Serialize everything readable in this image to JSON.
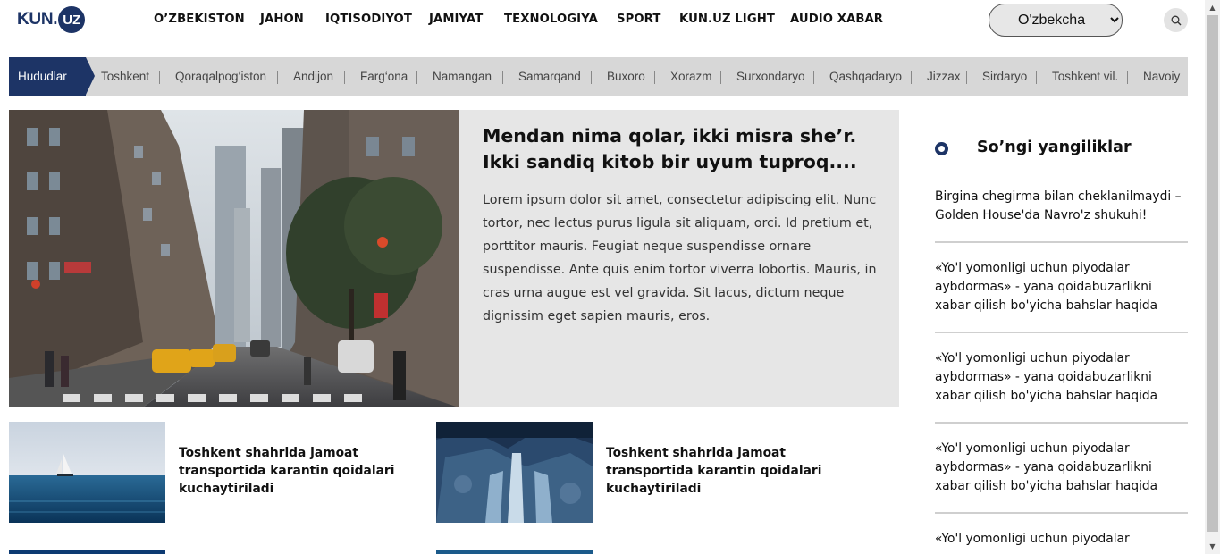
{
  "logo": {
    "text_a": "KUN.",
    "text_b": "UZ"
  },
  "nav": {
    "items": [
      "O’ZBEKISTON",
      "JAHON",
      "IQTISODIYOT",
      "JAMIYAT",
      "TEXNOLOGIYA",
      "SPORT",
      "KUN.UZ LIGHT",
      "AUDIO XABAR"
    ]
  },
  "language": {
    "selected": "O'zbekcha"
  },
  "search": {
    "icon": "search-icon"
  },
  "regions": {
    "heading": "Hududlar",
    "items": [
      "Toshkent",
      "Qoraqalpog‘iston",
      "Andijon",
      "Farg‘ona",
      "Namangan",
      "Samarqand",
      "Buxoro",
      "Xorazm",
      "Surxondaryo",
      "Qashqadaryo",
      "Jizzax",
      "Sirdaryo",
      "Toshkent vil.",
      "Navoiy"
    ]
  },
  "hero": {
    "title": "Mendan nima qolar, ikki misra she’r. Ikki sandiq kitob bir uyum tuproq....",
    "text": "Lorem ipsum dolor sit amet, consectetur adipiscing elit. Nunc tortor, nec lectus purus ligula sit aliquam, orci. Id pretium et, porttitor mauris. Feugiat neque suspendisse ornare suspendisse. Ante quis enim tortor viverra lobortis. Mauris, in cras urna augue est vel gravida. Sit lacus, dictum neque dignissim eget sapien mauris, eros."
  },
  "cards": [
    {
      "title": "Toshkent shahrida jamoat transportida karantin qoidalari kuchaytiriladi"
    },
    {
      "title": "Toshkent shahrida jamoat transportida karantin qoidalari kuchaytiriladi"
    }
  ],
  "latest": {
    "title": "So’ngi yangiliklar",
    "items": [
      "Birgina chegirma bilan cheklanilmaydi – Golden House'da Navro'z shukuhi!",
      "«Yo'l yomonligi uchun piyodalar aybdormas» - yana qoidabuzarlikni xabar qilish bo'yicha bahslar haqida",
      "«Yo'l yomonligi uchun piyodalar aybdormas» - yana qoidabuzarlikni xabar qilish bo'yicha bahslar haqida",
      "«Yo'l yomonligi uchun piyodalar aybdormas» - yana qoidabuzarlikni xabar qilish bo'yicha bahslar haqida",
      "«Yo'l yomonligi uchun piyodalar"
    ]
  },
  "colors": {
    "brand": "#1d3466",
    "region_bar": "#d7d7d7",
    "hero_bg": "#e6e6e6"
  }
}
